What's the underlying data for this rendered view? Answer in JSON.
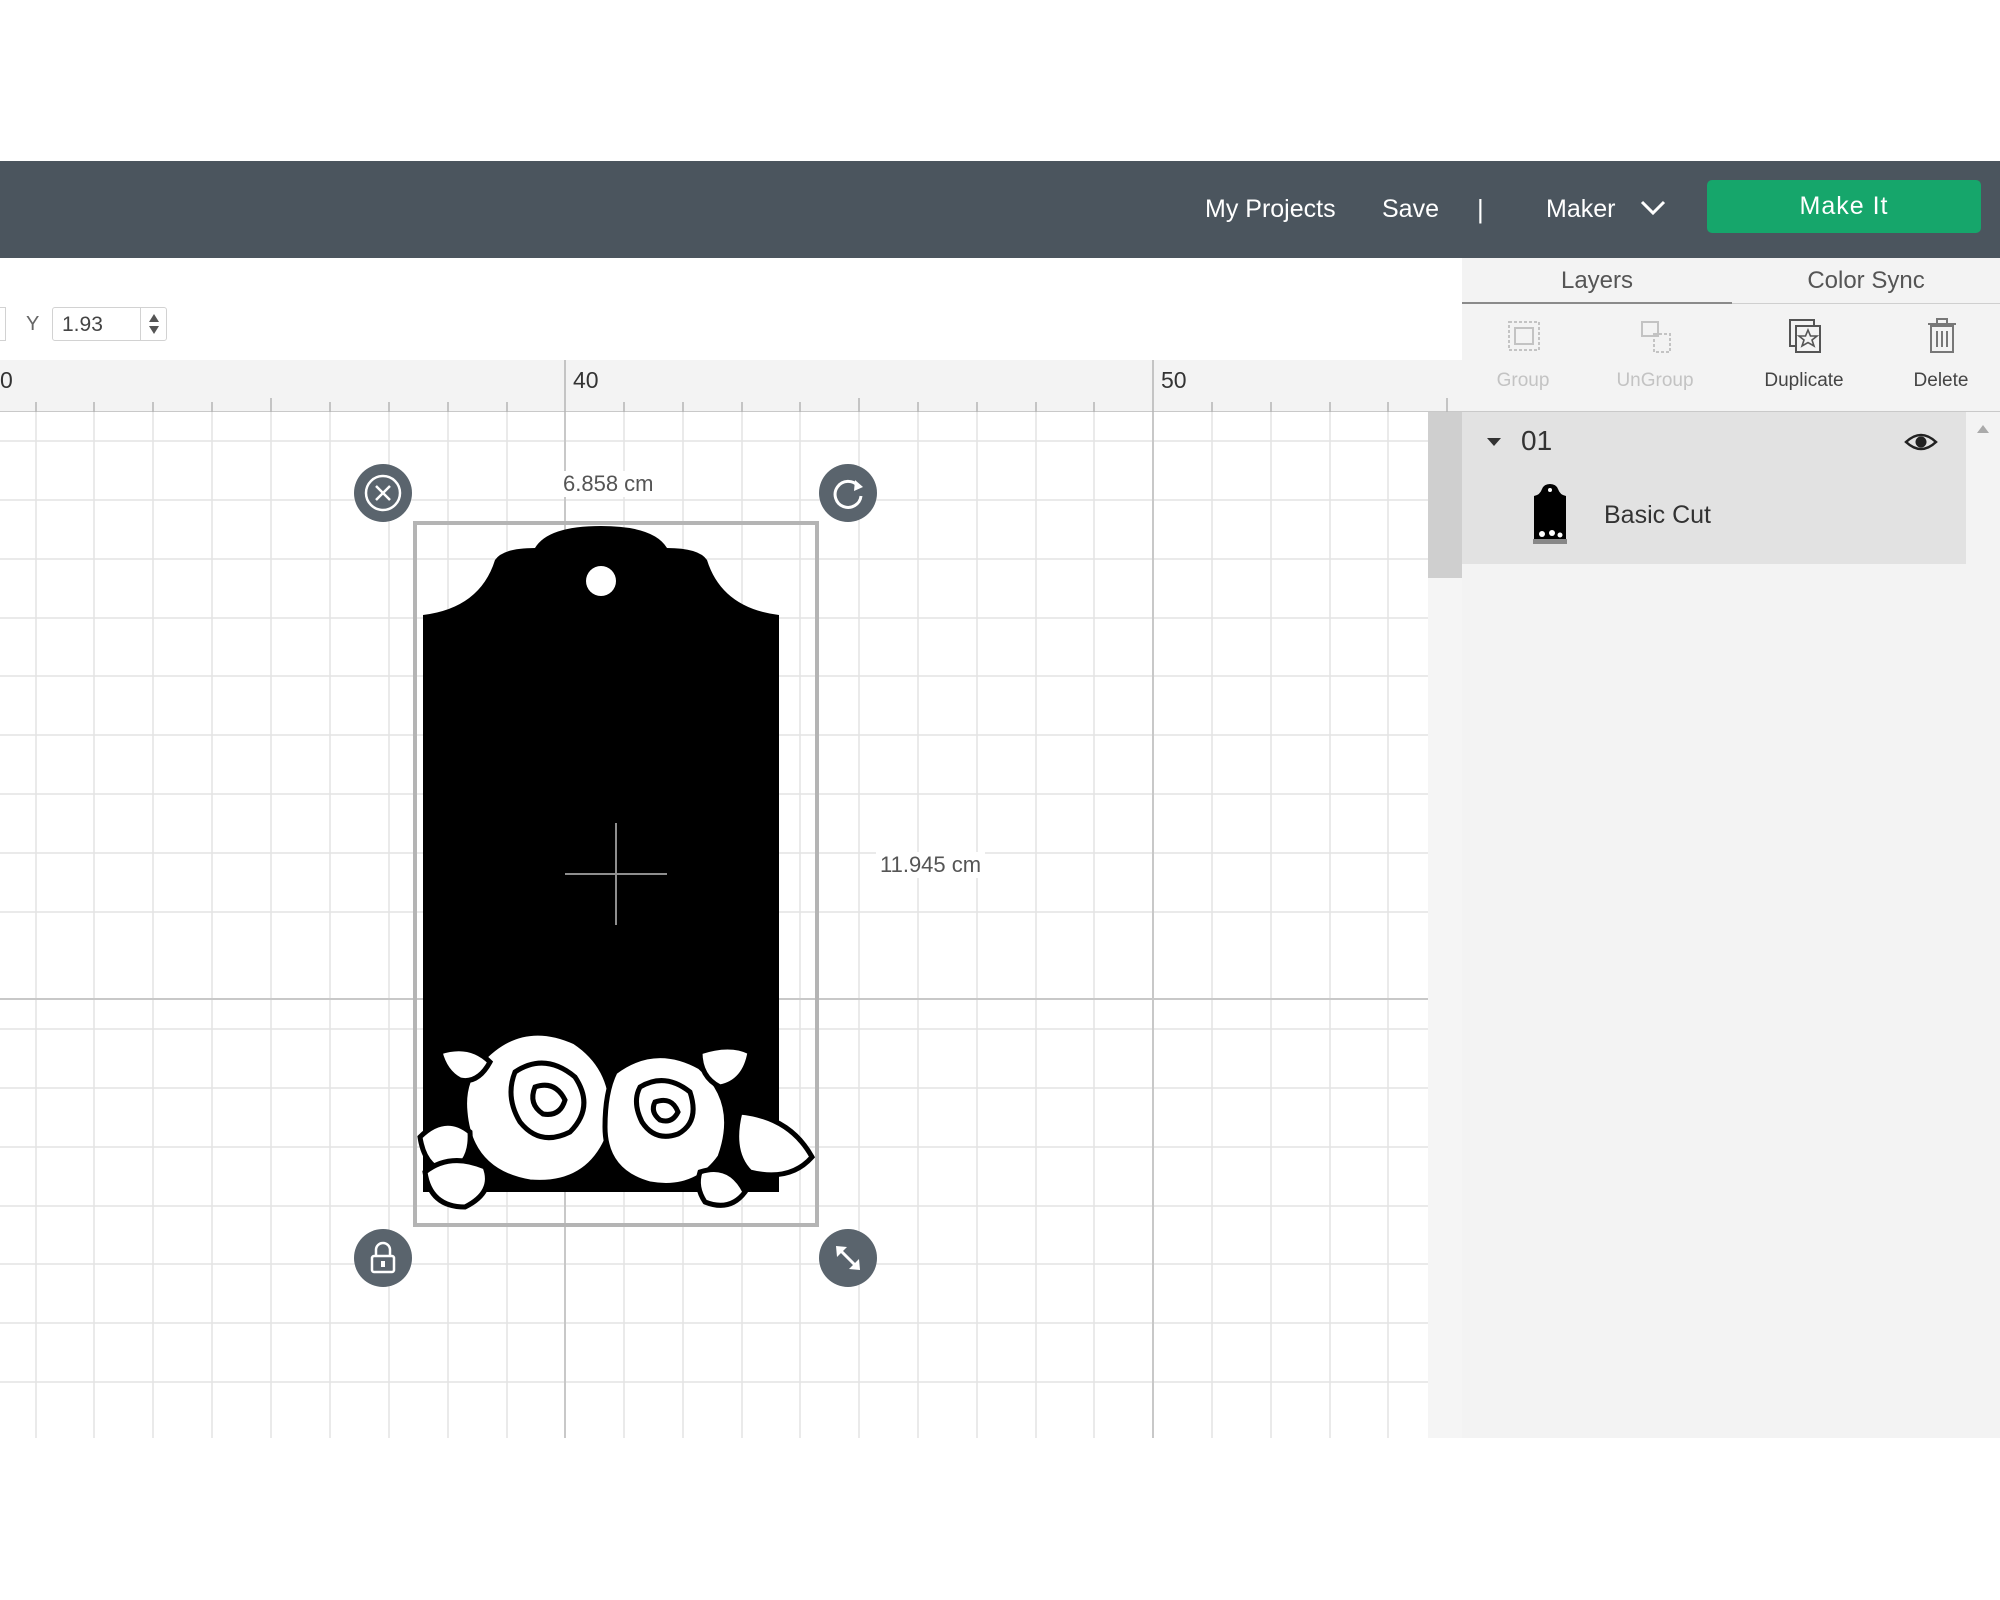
{
  "header": {
    "my_projects": "My Projects",
    "save": "Save",
    "divider": "|",
    "machine": "Maker",
    "make_it": "Make It",
    "colors": {
      "bar": "#4b555e",
      "make_it": "#16a66b"
    }
  },
  "toolbar": {
    "y_label": "Y",
    "y_value": "1.93"
  },
  "ruler": {
    "left_partial": "0",
    "marks": [
      "40",
      "50"
    ]
  },
  "canvas": {
    "selection_width": "6.858 cm",
    "selection_height": "11.945 cm",
    "handles": [
      "close-icon",
      "rotate-icon",
      "lock-icon",
      "resize-icon"
    ]
  },
  "panel": {
    "tabs": [
      {
        "label": "Layers",
        "active": true
      },
      {
        "label": "Color Sync",
        "active": false
      }
    ],
    "actions": [
      {
        "label": "Group",
        "enabled": false,
        "icon": "group-icon"
      },
      {
        "label": "UnGroup",
        "enabled": false,
        "icon": "ungroup-icon"
      },
      {
        "label": "Duplicate",
        "enabled": true,
        "icon": "duplicate-icon"
      },
      {
        "label": "Delete",
        "enabled": true,
        "icon": "trash-icon"
      }
    ],
    "layers": [
      {
        "group_name": "01",
        "visible": true,
        "items": [
          {
            "name": "Basic Cut",
            "thumbnail": "rose-tag-thumbnail"
          }
        ]
      }
    ]
  }
}
